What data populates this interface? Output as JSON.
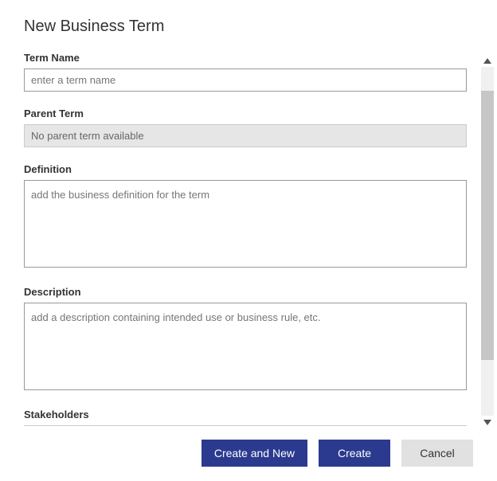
{
  "dialog": {
    "title": "New Business Term"
  },
  "fields": {
    "term_name": {
      "label": "Term Name",
      "placeholder": "enter a term name",
      "value": ""
    },
    "parent_term": {
      "label": "Parent Term",
      "value": "No parent term available"
    },
    "definition": {
      "label": "Definition",
      "placeholder": "add the business definition for the term",
      "value": ""
    },
    "description": {
      "label": "Description",
      "placeholder": "add a description containing intended use or business rule, etc.",
      "value": ""
    },
    "stakeholders": {
      "label": "Stakeholders"
    }
  },
  "buttons": {
    "create_and_new": "Create and New",
    "create": "Create",
    "cancel": "Cancel"
  }
}
